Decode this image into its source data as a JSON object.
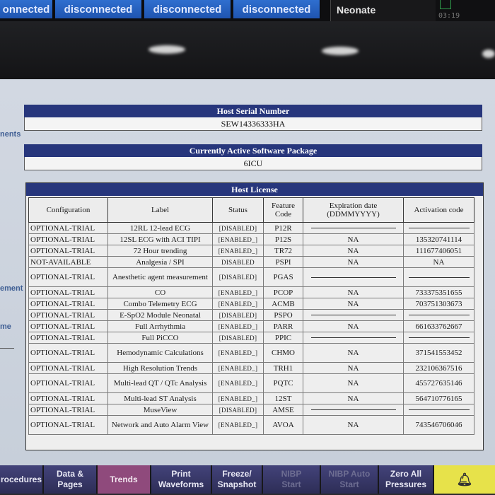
{
  "topbar": {
    "connections": [
      "onnected",
      "disconnected",
      "disconnected",
      "disconnected"
    ],
    "patient_category": "Neonate",
    "clock": "03:19"
  },
  "dialog": {
    "side_labels": [
      "nents",
      "ement",
      "me"
    ],
    "host_serial": {
      "heading": "Host Serial Number",
      "value": "SEW14336333HA"
    },
    "software_package": {
      "heading": "Currently Active Software Package",
      "value": "6ICU"
    },
    "license": {
      "heading": "Host License",
      "columns": [
        "Configuration",
        "Label",
        "Status",
        "Feature Code",
        "Expiration date (DDMMYYYY)",
        "Activation code"
      ],
      "rows": [
        {
          "config": "OPTIONAL-TRIAL",
          "label": "12RL 12-lead ECG",
          "status": "[DISABLED]",
          "code": "P12R",
          "expiration": "",
          "activation": ""
        },
        {
          "config": "OPTIONAL-TRIAL",
          "label": "12SL ECG with ACI TIPI",
          "status": "[ENABLED_]",
          "code": "P12S",
          "expiration": "NA",
          "activation": "135320741114"
        },
        {
          "config": "OPTIONAL-TRIAL",
          "label": "72 Hour trending",
          "status": "[ENABLED_]",
          "code": "TR72",
          "expiration": "NA",
          "activation": "111677406051"
        },
        {
          "config": "NOT-AVAILABLE",
          "label": "Analgesia / SPI",
          "status": "DISABLED",
          "code": "PSPI",
          "expiration": "NA",
          "activation": "NA"
        },
        {
          "config": "OPTIONAL-TRIAL",
          "label": "Anesthetic agent measurement",
          "status": "[DISABLED]",
          "code": "PGAS",
          "expiration": "",
          "activation": ""
        },
        {
          "config": "OPTIONAL-TRIAL",
          "label": "CO",
          "status": "[ENABLED_]",
          "code": "PCOP",
          "expiration": "NA",
          "activation": "733375351655"
        },
        {
          "config": "OPTIONAL-TRIAL",
          "label": "Combo Telemetry ECG",
          "status": "[ENABLED_]",
          "code": "ACMB",
          "expiration": "NA",
          "activation": "703751303673"
        },
        {
          "config": "OPTIONAL-TRIAL",
          "label": "E-SpO2 Module Neonatal",
          "status": "[DISABLED]",
          "code": "PSPO",
          "expiration": "",
          "activation": ""
        },
        {
          "config": "OPTIONAL-TRIAL",
          "label": "Full Arrhythmia",
          "status": "[ENABLED_]",
          "code": "PARR",
          "expiration": "NA",
          "activation": "661633762667"
        },
        {
          "config": "OPTIONAL-TRIAL",
          "label": "Full PiCCO",
          "status": "[DISABLED]",
          "code": "PPIC",
          "expiration": "",
          "activation": ""
        },
        {
          "config": "OPTIONAL-TRIAL",
          "label": "Hemodynamic Calculations",
          "status": "[ENABLED_]",
          "code": "CHMO",
          "expiration": "NA",
          "activation": "371541553452"
        },
        {
          "config": "OPTIONAL-TRIAL",
          "label": "High Resolution Trends",
          "status": "[ENABLED_]",
          "code": "TRH1",
          "expiration": "NA",
          "activation": "232106367516"
        },
        {
          "config": "OPTIONAL-TRIAL",
          "label": "Multi-lead QT / QTc Analysis",
          "status": "[ENABLED_]",
          "code": "PQTC",
          "expiration": "NA",
          "activation": "455727635146"
        },
        {
          "config": "OPTIONAL-TRIAL",
          "label": "Multi-lead ST Analysis",
          "status": "[ENABLED_]",
          "code": "12ST",
          "expiration": "NA",
          "activation": "564710776165"
        },
        {
          "config": "OPTIONAL-TRIAL",
          "label": "MuseView",
          "status": "[DISABLED]",
          "code": "AMSE",
          "expiration": "",
          "activation": ""
        },
        {
          "config": "OPTIONAL-TRIAL",
          "label": "Network and Auto Alarm View",
          "status": "[ENABLED_]",
          "code": "AVOA",
          "expiration": "NA",
          "activation": "743546706046"
        }
      ]
    }
  },
  "softkeys": [
    {
      "label": "rocedures",
      "enabled": true
    },
    {
      "label": "Data & Pages",
      "enabled": true
    },
    {
      "label": "Trends",
      "enabled": true
    },
    {
      "label": "Print Waveforms",
      "enabled": true
    },
    {
      "label": "Freeze/ Snapshot",
      "enabled": true
    },
    {
      "label": "NIBP Start",
      "enabled": false
    },
    {
      "label": "NIBP Auto Start",
      "enabled": false
    },
    {
      "label": "Zero All Pressures",
      "enabled": true
    }
  ],
  "alarm_icon": "bell-icon",
  "colors": {
    "header_navy": "#27367c",
    "connection_blue": "#2f6fcf",
    "softkey_purple": "#3a3a6e",
    "trends_key": "#8f4a7c",
    "alarm_key": "#e7e24a"
  }
}
